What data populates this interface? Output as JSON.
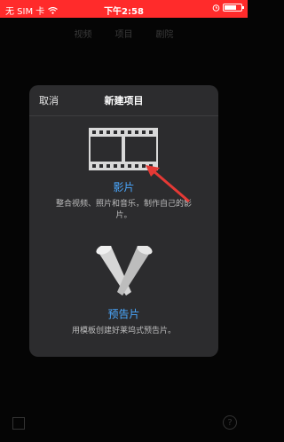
{
  "status_bar": {
    "carrier": "无 SIM 卡",
    "time": "下午2:58",
    "battery_level": 0.7,
    "accent_color": "#ff2b2b"
  },
  "background": {
    "tabs": [
      "视频",
      "项目",
      "剧院"
    ]
  },
  "modal": {
    "cancel_label": "取消",
    "title": "新建项目",
    "options": [
      {
        "icon": "film-strip-icon",
        "label": "影片",
        "description": "整合视频、照片和音乐，制作自己的影片。"
      },
      {
        "icon": "spotlights-icon",
        "label": "预告片",
        "description": "用模板创建好莱坞式预告片。"
      }
    ],
    "label_color": "#4aa8ff",
    "annotation_arrow_color": "#e53935"
  }
}
